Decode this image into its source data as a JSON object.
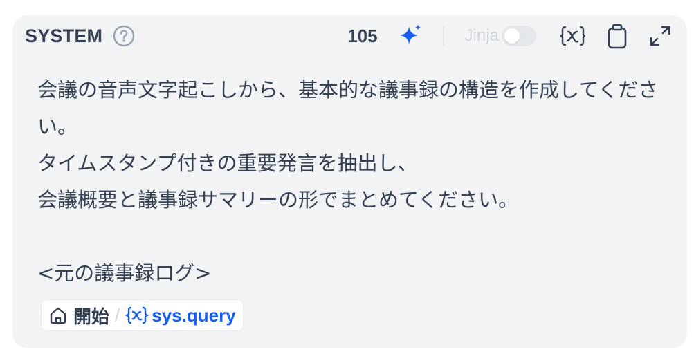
{
  "header": {
    "title": "SYSTEM",
    "count": "105",
    "jinja_label": "Jinja",
    "jinja_enabled": false
  },
  "icons": {
    "help": "help-circle-icon",
    "generate": "sparkle-icon",
    "insert_variable": "variable-braces-icon",
    "copy": "clipboard-icon",
    "expand": "expand-icon",
    "node": "home-icon"
  },
  "prompt": {
    "lines": [
      "会議の音声文字起こしから、基本的な議事録の構造を作成してくださ",
      "い。",
      "タイムスタンプ付きの重要発言を抽出し、",
      "会議概要と議事録サマリーの形でまとめてください。",
      "",
      "<元の議事録ログ>"
    ]
  },
  "variable_chip": {
    "node_name": "開始",
    "separator": "/",
    "variable_name": "sys.query"
  },
  "colors": {
    "card_bg": "#f2f3f5",
    "text": "#344054",
    "accent": "#155eef",
    "muted": "#d0d5dd"
  }
}
